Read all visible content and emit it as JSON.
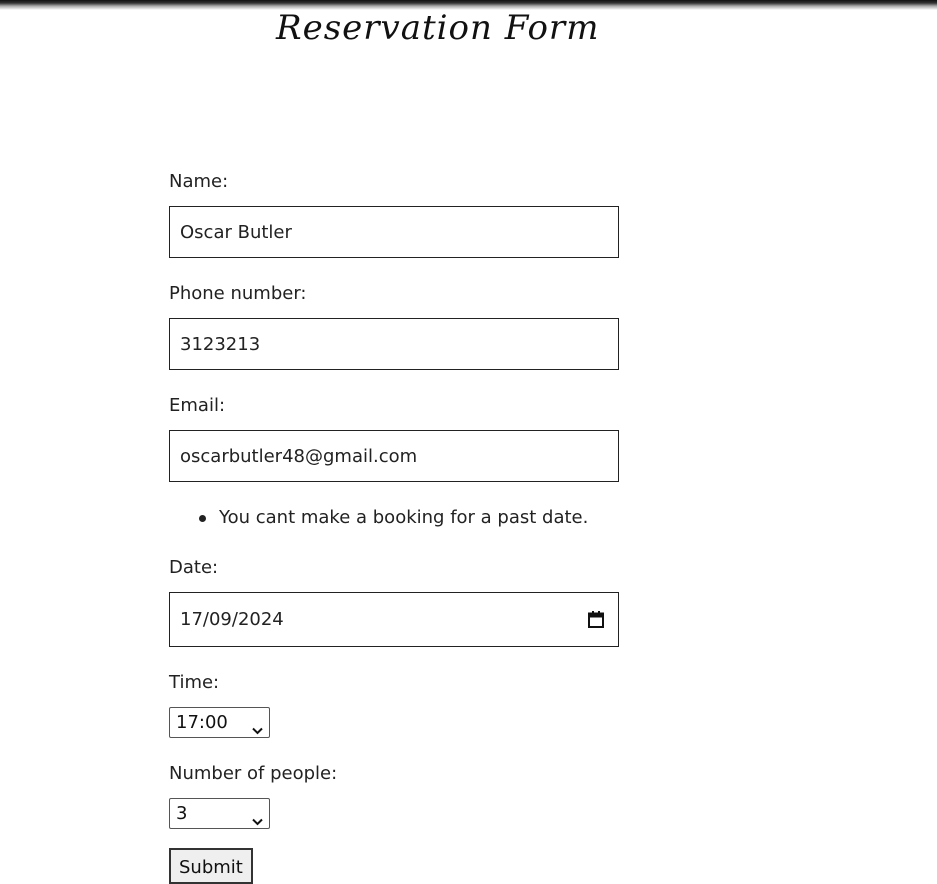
{
  "page": {
    "title": "Reservation Form"
  },
  "form": {
    "name": {
      "label": "Name:",
      "value": "Oscar Butler"
    },
    "phone": {
      "label": "Phone number:",
      "value": "3123213"
    },
    "email": {
      "label": "Email:",
      "value": "oscarbutler48@gmail.com"
    },
    "errors": [
      "You cant make a booking for a past date."
    ],
    "date": {
      "label": "Date:",
      "value": "17/09/2024",
      "icon": "calendar-icon"
    },
    "time": {
      "label": "Time:",
      "value": "17:00",
      "icon": "chevron-down-icon"
    },
    "people": {
      "label": "Number of people:",
      "value": "3",
      "icon": "chevron-down-icon"
    },
    "submit_label": "Submit"
  }
}
